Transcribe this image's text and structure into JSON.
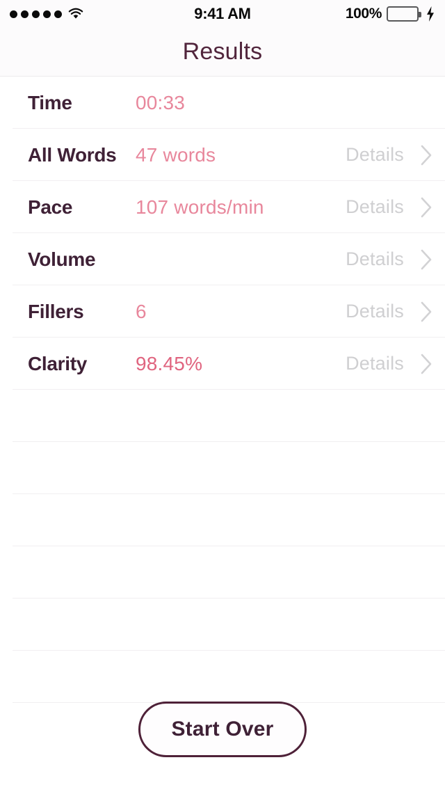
{
  "status_bar": {
    "signal_dots": 5,
    "wifi_icon": "wifi-icon",
    "time": "9:41 AM",
    "battery_percent": "100%",
    "battery_level": 100,
    "battery_color": "#4cd964",
    "charging_icon": "lightning-bolt-icon"
  },
  "nav": {
    "title": "Results"
  },
  "colors": {
    "label": "#3f2136",
    "value": "#e8879c",
    "details": "#cfcfd1",
    "separator": "#f1eff1",
    "button_border": "#4e2138"
  },
  "table": {
    "details_label": "Details",
    "chevron_icon": "chevron-right-icon",
    "rows": [
      {
        "label": "Time",
        "value": "00:33",
        "has_details": false
      },
      {
        "label": "All Words",
        "value": "47 words",
        "has_details": true
      },
      {
        "label": "Pace",
        "value": "107 words/min",
        "has_details": true
      },
      {
        "label": "Volume",
        "value": "",
        "has_details": true
      },
      {
        "label": "Fillers",
        "value": "6",
        "has_details": true
      },
      {
        "label": "Clarity",
        "value": "98.45%",
        "has_details": true
      }
    ],
    "empty_row_count": 6
  },
  "footer": {
    "start_over_label": "Start Over"
  }
}
